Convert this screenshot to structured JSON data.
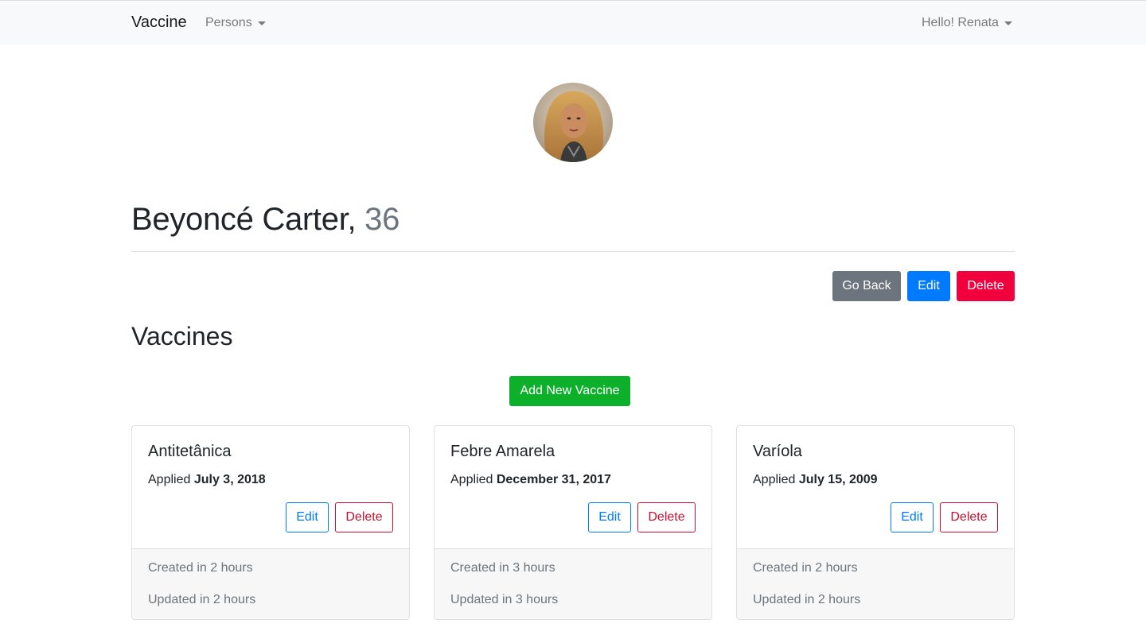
{
  "navbar": {
    "brand": "Vaccine",
    "persons_label": "Persons",
    "user_label": "Hello! Renata"
  },
  "person": {
    "name": "Beyoncé Carter,",
    "age": "36"
  },
  "actions": {
    "go_back": "Go Back",
    "edit": "Edit",
    "delete": "Delete"
  },
  "vaccines": {
    "title": "Vaccines",
    "add_button": "Add New Vaccine",
    "cards": [
      {
        "name": "Antitetânica",
        "applied_prefix": "Applied",
        "applied_date": "July 3, 2018",
        "edit": "Edit",
        "delete": "Delete",
        "created": "Created in 2 hours",
        "updated": "Updated in 2 hours"
      },
      {
        "name": "Febre Amarela",
        "applied_prefix": "Applied",
        "applied_date": "December 31, 2017",
        "edit": "Edit",
        "delete": "Delete",
        "created": "Created in 3 hours",
        "updated": "Updated in 3 hours"
      },
      {
        "name": "Varíola",
        "applied_prefix": "Applied",
        "applied_date": "July 15, 2009",
        "edit": "Edit",
        "delete": "Delete",
        "created": "Created in 2 hours",
        "updated": "Updated in 2 hours"
      }
    ]
  },
  "colors": {
    "primary": "#007bff",
    "secondary": "#6c757d",
    "danger": "#f0003c",
    "success": "#0db02b"
  }
}
